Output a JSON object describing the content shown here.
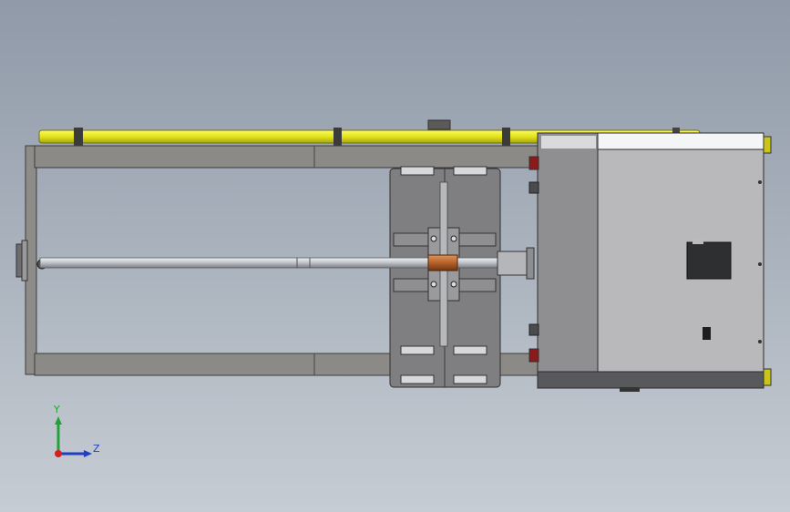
{
  "triad": {
    "y_label": "Y",
    "z_label": "Z"
  },
  "colors": {
    "background_top": "#909aa8",
    "background_bottom": "#c6ccd3",
    "frame_steel": "#8c8a86",
    "rail_yellow": "#e6e61a",
    "housing_grey": "#b9b9bb",
    "plate_dark": "#7f7f82",
    "screw_silver": "#c9cbcf",
    "nut_copper": "#b5622a",
    "axis_y_green": "#22a33a",
    "axis_z_blue": "#1f3fbf",
    "origin_red": "#d81f1f"
  },
  "icons": [
    "view-triad-icon",
    "origin-dot-icon"
  ]
}
